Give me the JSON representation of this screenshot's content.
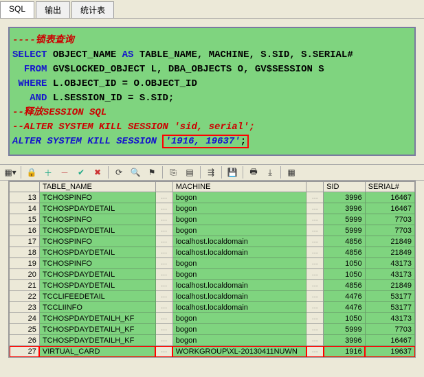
{
  "tabs": {
    "t0": "SQL",
    "t1": "输出",
    "t2": "统计表"
  },
  "sql": {
    "l1": "----锁表查询",
    "l2_a": "SELECT",
    "l2_b": "OBJECT_NAME",
    "l2_c": "AS",
    "l2_d": "TABLE_NAME, MACHINE, S.SID, S.SERIAL#",
    "l3_a": "FROM",
    "l3_b": "GV$LOCKED_OBJECT L, DBA_OBJECTS O, GV$SESSION S",
    "l4_a": "WHERE",
    "l4_b": "L.OBJECT_ID   = O.OBJECT_ID",
    "l5_a": "AND",
    "l5_b": "L.SESSION_ID = S.SID;",
    "l6": "--释放SESSION SQL",
    "l7": "--ALTER SYSTEM KILL SESSION 'sid, serial';",
    "l8_a": "ALTER",
    "l8_b": "SYSTEM",
    "l8_c": "KILL",
    "l8_d": "SESSION",
    "l8_e": "'1916, 19637'",
    "l8_f": ";"
  },
  "grid": {
    "headers": {
      "h1": "TABLE_NAME",
      "h2": "MACHINE",
      "h3": "SID",
      "h4": "SERIAL#"
    },
    "rows": [
      {
        "n": "13",
        "table": "TCHOSPINFO",
        "machine": "bogon",
        "sid": "3996",
        "serial": "16467"
      },
      {
        "n": "14",
        "table": "TCHOSPDAYDETAIL",
        "machine": "bogon",
        "sid": "3996",
        "serial": "16467"
      },
      {
        "n": "15",
        "table": "TCHOSPINFO",
        "machine": "bogon",
        "sid": "5999",
        "serial": "7703"
      },
      {
        "n": "16",
        "table": "TCHOSPDAYDETAIL",
        "machine": "bogon",
        "sid": "5999",
        "serial": "7703"
      },
      {
        "n": "17",
        "table": "TCHOSPINFO",
        "machine": "localhost.localdomain",
        "sid": "4856",
        "serial": "21849"
      },
      {
        "n": "18",
        "table": "TCHOSPDAYDETAIL",
        "machine": "localhost.localdomain",
        "sid": "4856",
        "serial": "21849"
      },
      {
        "n": "19",
        "table": "TCHOSPINFO",
        "machine": "bogon",
        "sid": "1050",
        "serial": "43173"
      },
      {
        "n": "20",
        "table": "TCHOSPDAYDETAIL",
        "machine": "bogon",
        "sid": "1050",
        "serial": "43173"
      },
      {
        "n": "21",
        "table": "TCHOSPDAYDETAIL",
        "machine": "localhost.localdomain",
        "sid": "4856",
        "serial": "21849"
      },
      {
        "n": "22",
        "table": "TCCLIFEEDETAIL",
        "machine": "localhost.localdomain",
        "sid": "4476",
        "serial": "53177"
      },
      {
        "n": "23",
        "table": "TCCLIINFO",
        "machine": "localhost.localdomain",
        "sid": "4476",
        "serial": "53177"
      },
      {
        "n": "24",
        "table": "TCHOSPDAYDETAILH_KF",
        "machine": "bogon",
        "sid": "1050",
        "serial": "43173"
      },
      {
        "n": "25",
        "table": "TCHOSPDAYDETAILH_KF",
        "machine": "bogon",
        "sid": "5999",
        "serial": "7703"
      },
      {
        "n": "26",
        "table": "TCHOSPDAYDETAILH_KF",
        "machine": "bogon",
        "sid": "3996",
        "serial": "16467"
      },
      {
        "n": "27",
        "table": "VIRTUAL_CARD",
        "machine": "WORKGROUP\\XL-20130411NUWN",
        "sid": "1916",
        "serial": "19637",
        "highlight": true
      }
    ]
  }
}
